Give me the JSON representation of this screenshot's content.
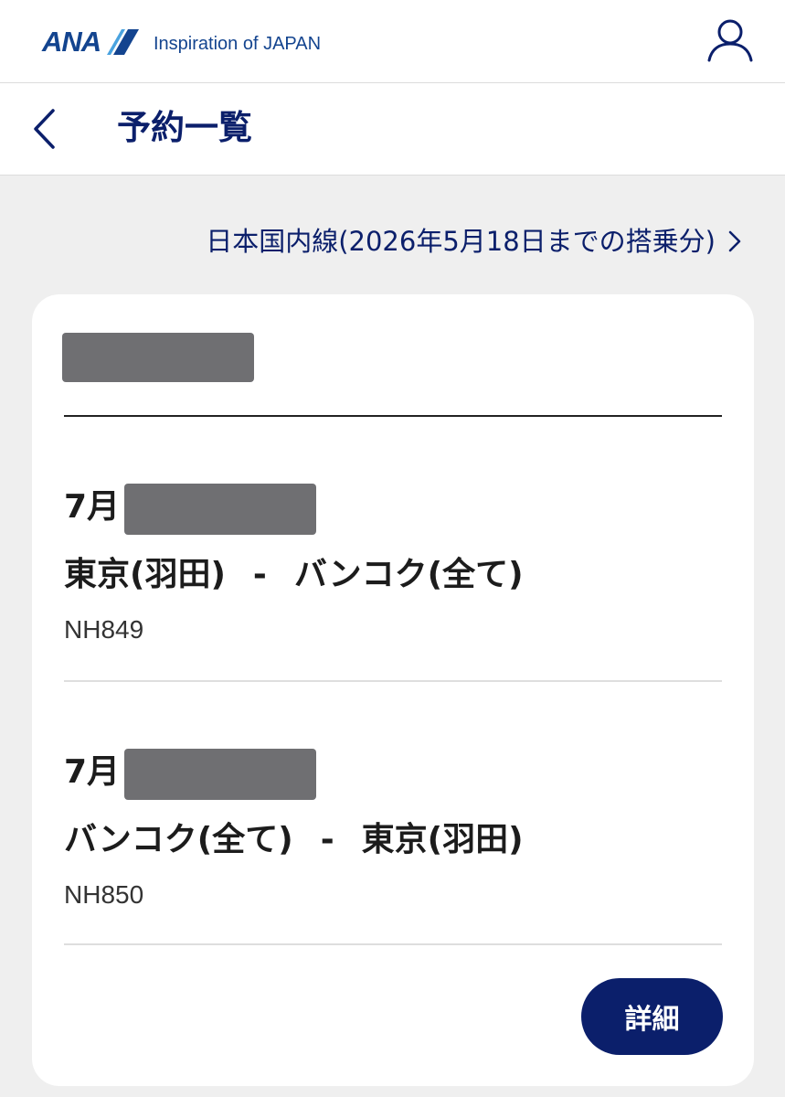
{
  "brand": {
    "logo_text": "ANA",
    "tagline": "Inspiration of JAPAN",
    "color": "#13448f"
  },
  "header": {
    "profile_icon": "user-icon"
  },
  "page": {
    "back_icon": "chevron-left-icon",
    "title": "予約一覧"
  },
  "domestic_link": {
    "label": "日本国内線(2026年5月18日までの搭乗分)",
    "icon": "chevron-right-icon"
  },
  "reservation": {
    "segments": [
      {
        "month": "7月",
        "origin": "東京(羽田)",
        "separator": "-",
        "destination": "バンコク(全て)",
        "flight": "NH849"
      },
      {
        "month": "7月",
        "origin": "バンコク(全て)",
        "separator": "-",
        "destination": "東京(羽田)",
        "flight": "NH850"
      }
    ],
    "details_label": "詳細"
  },
  "colors": {
    "accent": "#0b1f6b",
    "background": "#efefef",
    "card": "#ffffff",
    "redaction": "#6f6f72"
  }
}
